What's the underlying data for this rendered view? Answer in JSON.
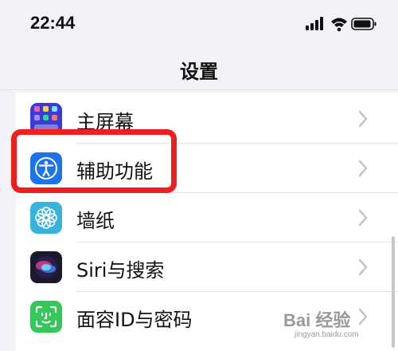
{
  "status_bar": {
    "time": "22:44"
  },
  "nav": {
    "title": "设置"
  },
  "settings_list": [
    {
      "label": "主屏幕",
      "icon": "home-screen-icon",
      "icon_color": "#3b3bd6"
    },
    {
      "label": "辅助功能",
      "icon": "accessibility-icon",
      "icon_color": "#1b74e8"
    },
    {
      "label": "墙纸",
      "icon": "wallpaper-icon",
      "icon_color": "#38b4dc"
    },
    {
      "label": "Siri与搜索",
      "icon": "siri-icon",
      "icon_color": "#1a1a2e"
    },
    {
      "label": "面容ID与密码",
      "icon": "face-id-icon",
      "icon_color": "#34c759"
    }
  ],
  "highlight_color": "#ef1f1f",
  "watermark": {
    "brand": "Bai 经验",
    "url": "jingyan.baidu.com"
  }
}
